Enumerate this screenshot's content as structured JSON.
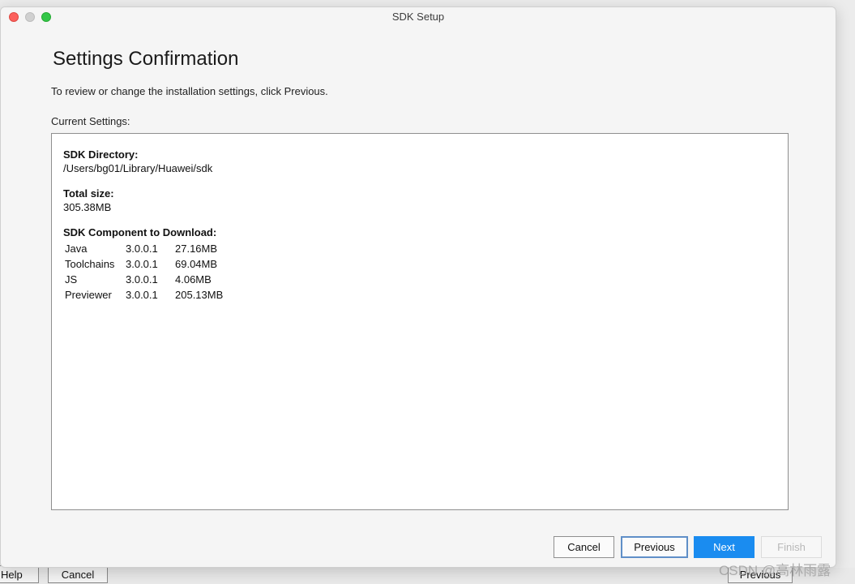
{
  "window": {
    "title": "SDK Setup"
  },
  "page": {
    "title": "Settings Confirmation",
    "instruction": "To review or change the installation settings, click Previous.",
    "current_settings_label": "Current Settings:"
  },
  "settings": {
    "sdk_directory_label": "SDK Directory:",
    "sdk_directory_value": "/Users/bg01/Library/Huawei/sdk",
    "total_size_label": "Total size:",
    "total_size_value": "305.38MB",
    "components_label": "SDK Component to Download:",
    "components": [
      {
        "name": "Java",
        "version": "3.0.0.1",
        "size": "27.16MB"
      },
      {
        "name": "Toolchains",
        "version": "3.0.0.1",
        "size": "69.04MB"
      },
      {
        "name": "JS",
        "version": "3.0.0.1",
        "size": "4.06MB"
      },
      {
        "name": "Previewer",
        "version": "3.0.0.1",
        "size": "205.13MB"
      }
    ]
  },
  "buttons": {
    "cancel": "Cancel",
    "previous": "Previous",
    "next": "Next",
    "finish": "Finish"
  },
  "background_window": {
    "help": "Help",
    "cancel": "Cancel",
    "previous": "Previous"
  },
  "watermark": "CSDN @高林雨露",
  "colors": {
    "next_button": "#1a8cf0",
    "close_button": "#fc605c",
    "minimize_button": "#d0d0d0",
    "zoom_button": "#33c748"
  }
}
